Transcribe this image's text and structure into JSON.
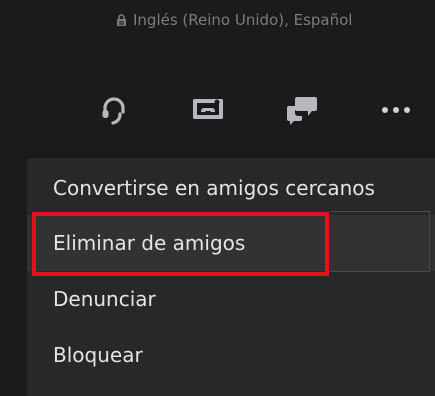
{
  "profile": {
    "languages": "Inglés (Reino Unido), Español"
  },
  "actions": {
    "items": [
      {
        "name": "voice-chat",
        "icon": "headset-icon"
      },
      {
        "name": "share-screen",
        "icon": "screen-share-icon"
      },
      {
        "name": "message",
        "icon": "chat-bubbles-icon"
      },
      {
        "name": "more-options",
        "icon": "more-dots-icon"
      }
    ]
  },
  "menu": {
    "items": [
      {
        "label": "Convertirse en amigos cercanos"
      },
      {
        "label": "Eliminar de amigos",
        "focused": true
      },
      {
        "label": "Denunciar"
      },
      {
        "label": "Bloquear"
      }
    ]
  },
  "colors": {
    "background": "#1b1b1d",
    "menu_background": "#28282a",
    "text": "#e4e4e6",
    "muted_text": "#7c7c80",
    "highlight": "#e0141e"
  }
}
